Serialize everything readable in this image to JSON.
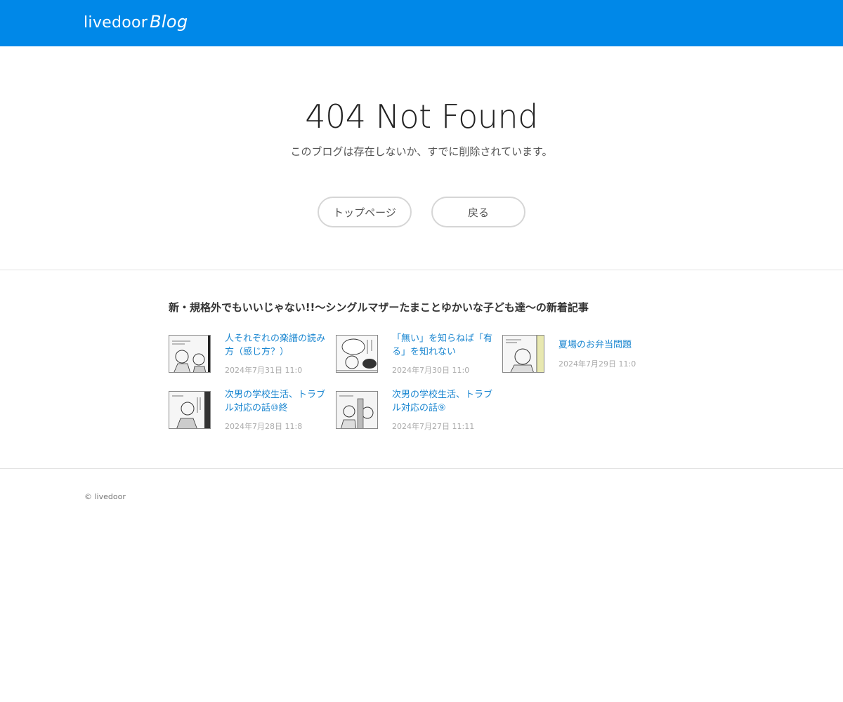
{
  "header": {
    "logo_text": "livedoor",
    "logo_blog": "Blog"
  },
  "error": {
    "title": "404 Not Found",
    "message": "このブログは存在しないか、すでに削除されています。",
    "top_button": "トップページ",
    "back_button": "戻る"
  },
  "articles": {
    "heading": "新・規格外でもいいじゃない!!〜シングルマザーたまことゆかいな子ども達〜の新着記事",
    "items": [
      {
        "title": "人それぞれの楽譜の読み方（感じ方？）",
        "date": "2024年7月31日 11:0"
      },
      {
        "title": "「無い」を知らねば「有る」を知れない",
        "date": "2024年7月30日 11:0"
      },
      {
        "title": "夏場のお弁当問題",
        "date": "2024年7月29日 11:0"
      },
      {
        "title": "次男の学校生活、トラブル対応の話⑩終",
        "date": "2024年7月28日 11:8"
      },
      {
        "title": "次男の学校生活、トラブル対応の話⑨",
        "date": "2024年7月27日 11:11"
      }
    ]
  },
  "footer": {
    "copyright": "© livedoor"
  },
  "colors": {
    "header_bg": "#0088e8",
    "link": "#1a86d0",
    "muted": "#aaaaaa"
  }
}
